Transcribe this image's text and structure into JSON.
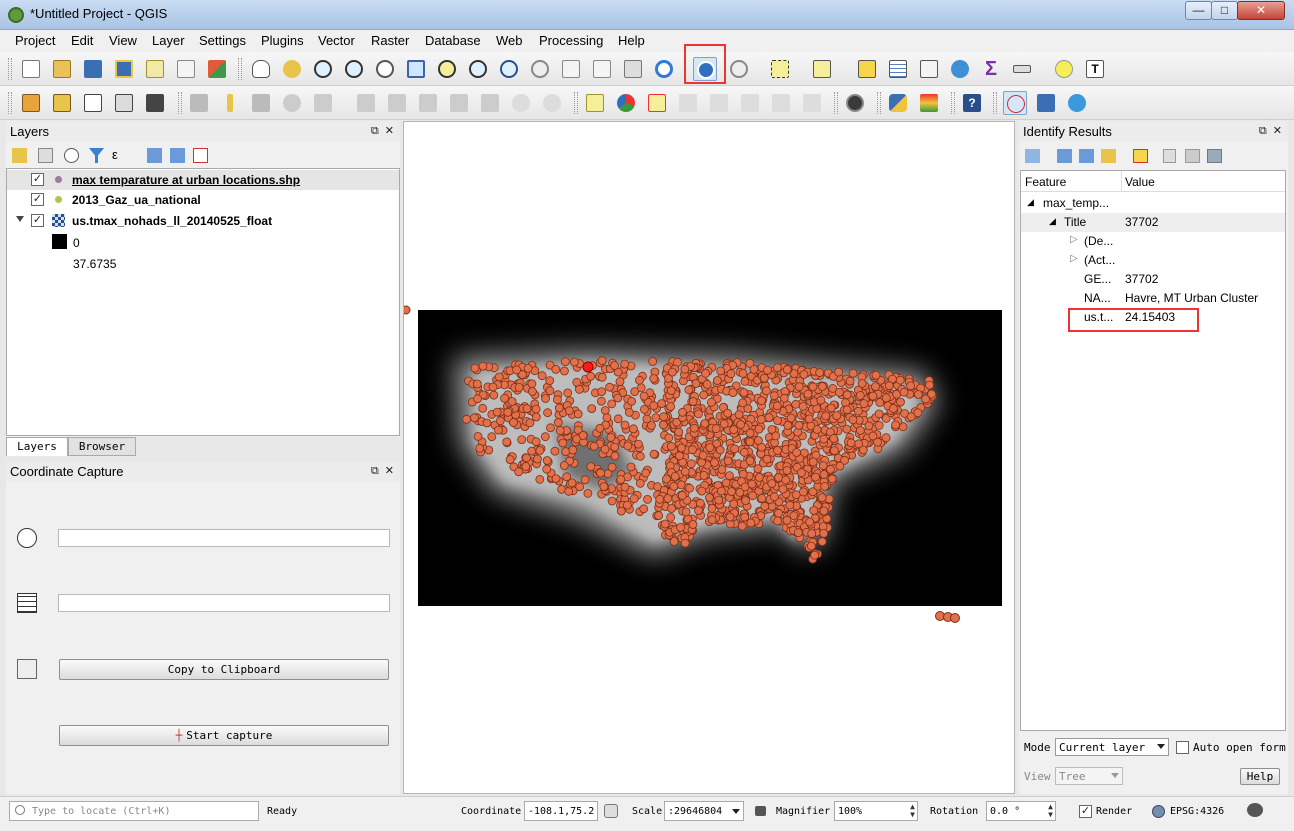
{
  "window": {
    "title": "*Untitled Project - QGIS",
    "minimize": "—",
    "maximize": "□",
    "close": "✕"
  },
  "menu": [
    "Project",
    "Edit",
    "View",
    "Layer",
    "Settings",
    "Plugins",
    "Vector",
    "Raster",
    "Database",
    "Web",
    "Processing",
    "Help"
  ],
  "layers_panel": {
    "title": "Layers",
    "items": [
      {
        "name": "max temparature at urban locations.shp",
        "checked": true
      },
      {
        "name": "2013_Gaz_ua_national",
        "checked": true
      },
      {
        "name": "us.tmax_nohads_ll_20140525_float",
        "checked": true
      }
    ],
    "legend_min": "0",
    "legend_max": "37.6735",
    "tabs": [
      "Layers",
      "Browser"
    ]
  },
  "coordinate_capture": {
    "title": "Coordinate Capture",
    "copy_button": "Copy to Clipboard",
    "start_button": "Start capture"
  },
  "identify": {
    "title": "Identify Results",
    "col_feature": "Feature",
    "col_value": "Value",
    "rows": [
      {
        "feature": "max_temp...",
        "value": ""
      },
      {
        "feature": "Title",
        "value": "37702"
      },
      {
        "feature": "(De...",
        "value": ""
      },
      {
        "feature": "(Act...",
        "value": ""
      },
      {
        "feature": "GE...",
        "value": "37702"
      },
      {
        "feature": "NA...",
        "value": "Havre, MT Urban Cluster"
      },
      {
        "feature": "us.t...",
        "value": "24.15403"
      }
    ],
    "mode_label": "Mode",
    "mode_value": "Current layer",
    "auto_open": "Auto open form",
    "view_label": "View",
    "view_value": "Tree",
    "help": "Help"
  },
  "status": {
    "locate_placeholder": "Type to locate (Ctrl+K)",
    "ready": "Ready",
    "coordinate_label": "Coordinate",
    "coordinate_value": "-108.1,75.2",
    "scale_label": "Scale",
    "scale_value": ":29646804",
    "magnifier_label": "Magnifier",
    "magnifier_value": "100%",
    "rotation_label": "Rotation",
    "rotation_value": "0.0 °",
    "render_label": "Render",
    "crs": "EPSG:4326"
  },
  "colors": {
    "point_fill": "#e2704a",
    "point_stroke": "#7a2f18",
    "selected_point": "#ff1a1a",
    "highlight": "#e33333"
  }
}
